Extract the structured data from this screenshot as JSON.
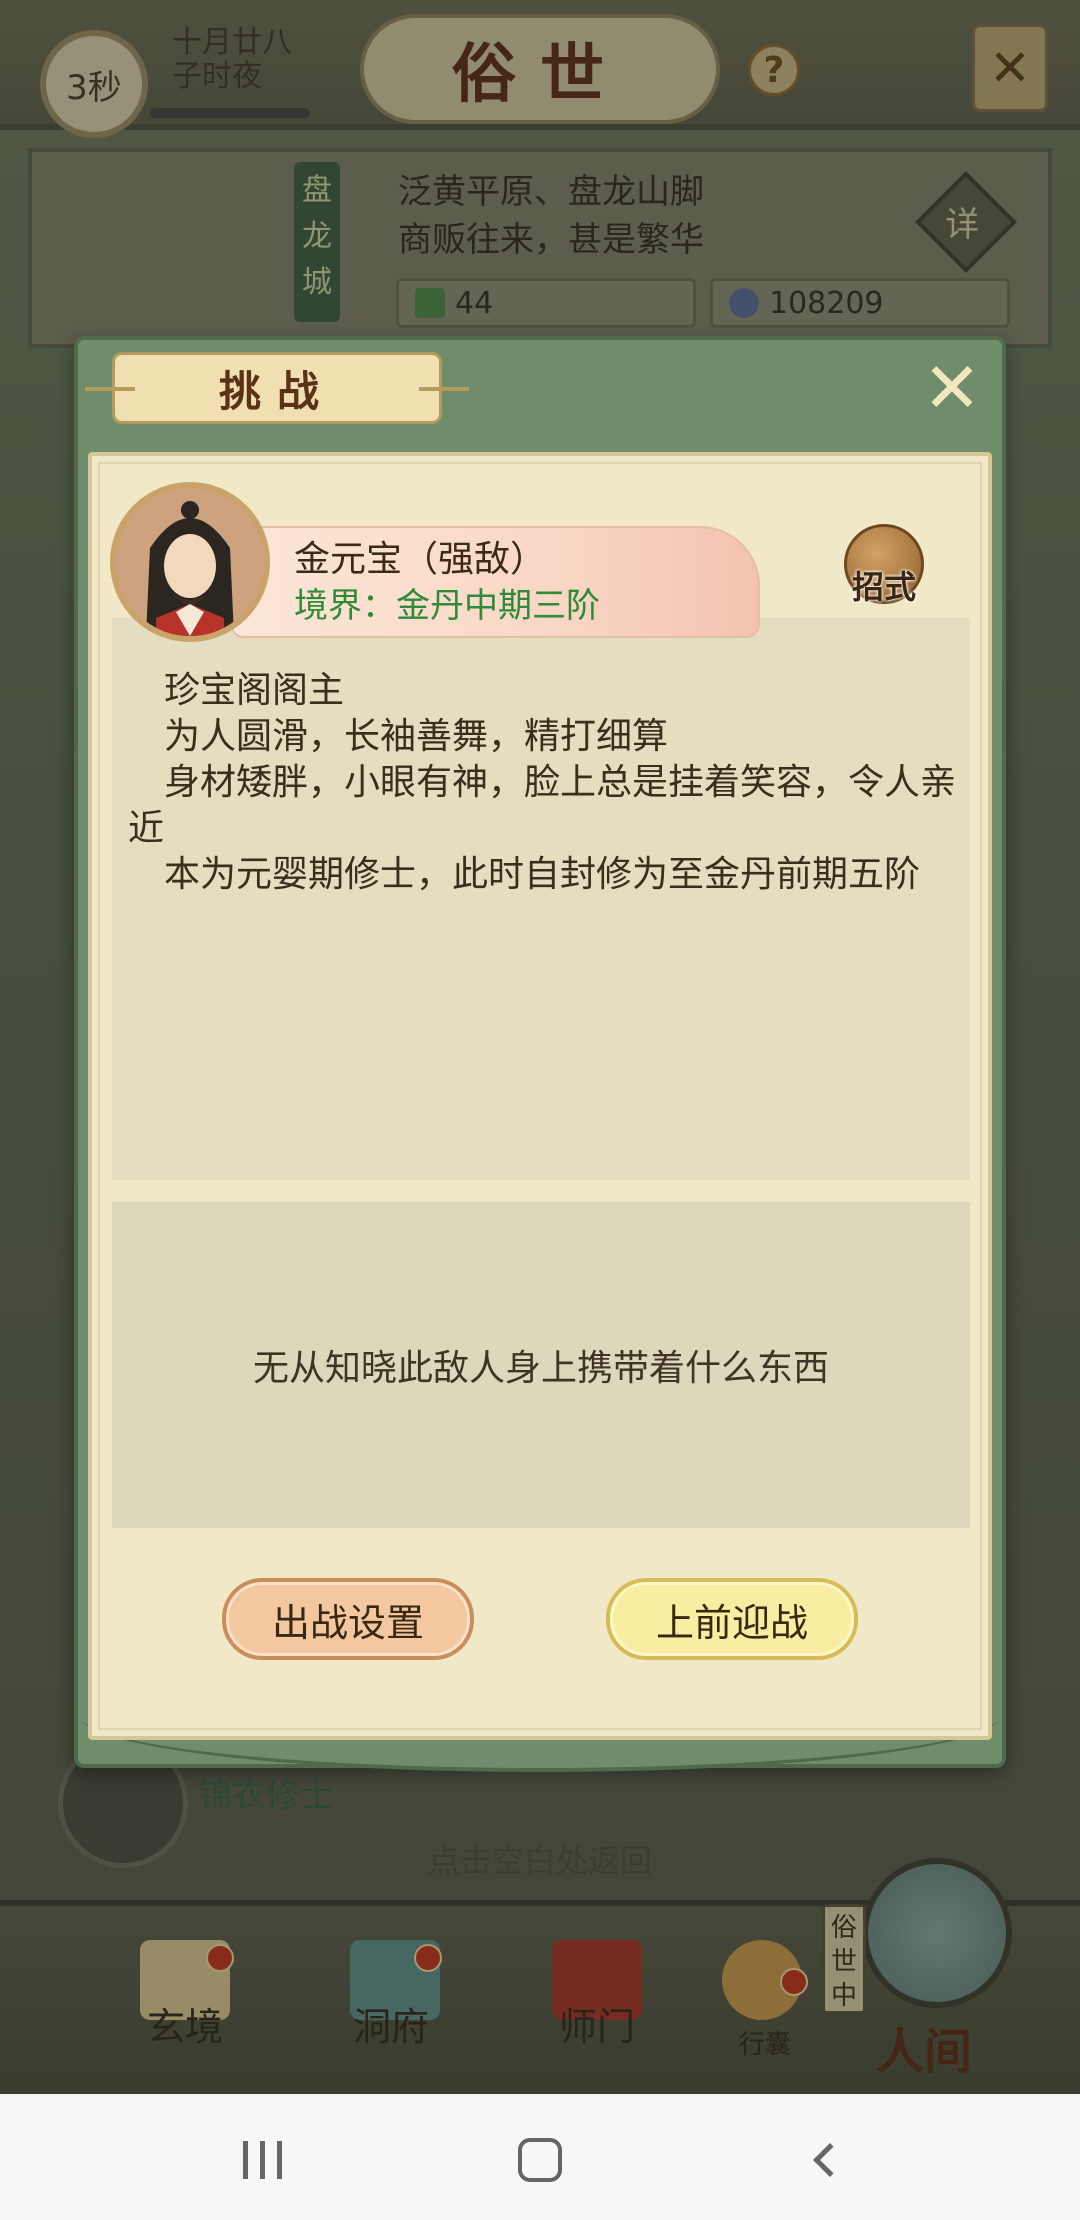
{
  "topbar": {
    "timer": "3秒",
    "date_line1": "十月廿八",
    "date_line2": "子时夜",
    "title": "俗世",
    "help": "?"
  },
  "city": {
    "name": "盘龙城",
    "desc_line1": "泛黄平原、盘龙山脚",
    "desc_line2": "商贩往来，甚是繁华",
    "detail_label": "详",
    "resource1": "44",
    "resource2": "108209"
  },
  "background": {
    "peek_name": "锦衣修士",
    "hint": "点击空白处返回"
  },
  "dialog": {
    "title": "挑战",
    "enemy_name": "金元宝（强敌）",
    "enemy_realm": "境界：金丹中期三阶",
    "skill_label": "招式",
    "desc_lines": [
      "　珍宝阁阁主",
      "　为人圆滑，长袖善舞，精打细算",
      "　身材矮胖，小眼有神，脸上总是挂着笑容，令人亲近",
      "　本为元婴期修士，此时自封修为至金丹前期五阶"
    ],
    "loot_text": "无从知晓此敌人身上携带着什么东西",
    "btn_setup": "出战设置",
    "btn_fight": "上前迎战"
  },
  "bottom_nav": {
    "items": [
      "玄境",
      "洞府",
      "师门",
      "行囊"
    ],
    "world_tag": "俗世中",
    "world_label": "人间"
  },
  "colors": {
    "dialog_frame": "#6f8c6b",
    "paper": "#f1e8c8",
    "realm_green": "#2f8a3a",
    "btn_setup": "#f3c7a0",
    "btn_fight": "#f8eda0"
  }
}
